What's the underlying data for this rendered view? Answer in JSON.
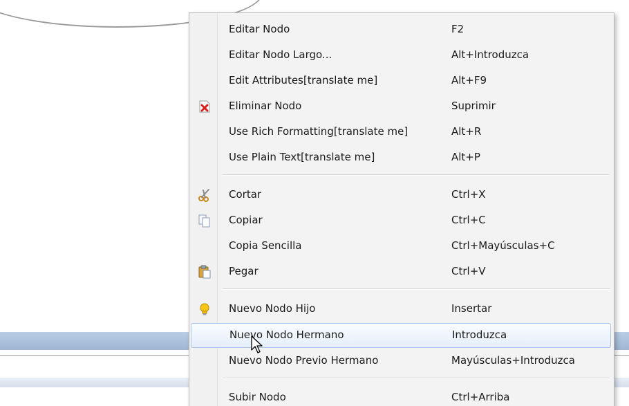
{
  "context_menu": {
    "items": [
      {
        "label": "Editar Nodo",
        "shortcut": "F2",
        "icon": ""
      },
      {
        "label": "Editar Nodo Largo...",
        "shortcut": "Alt+Introduzca",
        "icon": ""
      },
      {
        "label": "Edit Attributes[translate me]",
        "shortcut": "Alt+F9",
        "icon": ""
      },
      {
        "label": "Eliminar Nodo",
        "shortcut": "Suprimir",
        "icon": "delete-icon"
      },
      {
        "label": "Use Rich Formatting[translate me]",
        "shortcut": "Alt+R",
        "icon": ""
      },
      {
        "label": "Use Plain Text[translate me]",
        "shortcut": "Alt+P",
        "icon": ""
      },
      {
        "label": "Cortar",
        "shortcut": "Ctrl+X",
        "icon": "scissors-icon"
      },
      {
        "label": "Copiar",
        "shortcut": "Ctrl+C",
        "icon": "copy-icon"
      },
      {
        "label": "Copia Sencilla",
        "shortcut": "Ctrl+Mayúsculas+C",
        "icon": ""
      },
      {
        "label": "Pegar",
        "shortcut": "Ctrl+V",
        "icon": "paste-icon"
      },
      {
        "label": "Nuevo Nodo Hijo",
        "shortcut": "Insertar",
        "icon": "lightbulb-icon"
      },
      {
        "label": "Nuevo Nodo Hermano",
        "shortcut": "Introduzca",
        "icon": "",
        "highlighted": true
      },
      {
        "label": "Nuevo Nodo Previo Hermano",
        "shortcut": "Mayúsculas+Introduzca",
        "icon": ""
      },
      {
        "label": "Subir Nodo",
        "shortcut": "Ctrl+Arriba",
        "icon": ""
      }
    ]
  },
  "colors": {
    "menu_background": "#f3f3f3",
    "hover_border": "#a8c4e6",
    "delete_icon_red": "#d62020",
    "lightbulb_yellow": "#f5c518"
  }
}
